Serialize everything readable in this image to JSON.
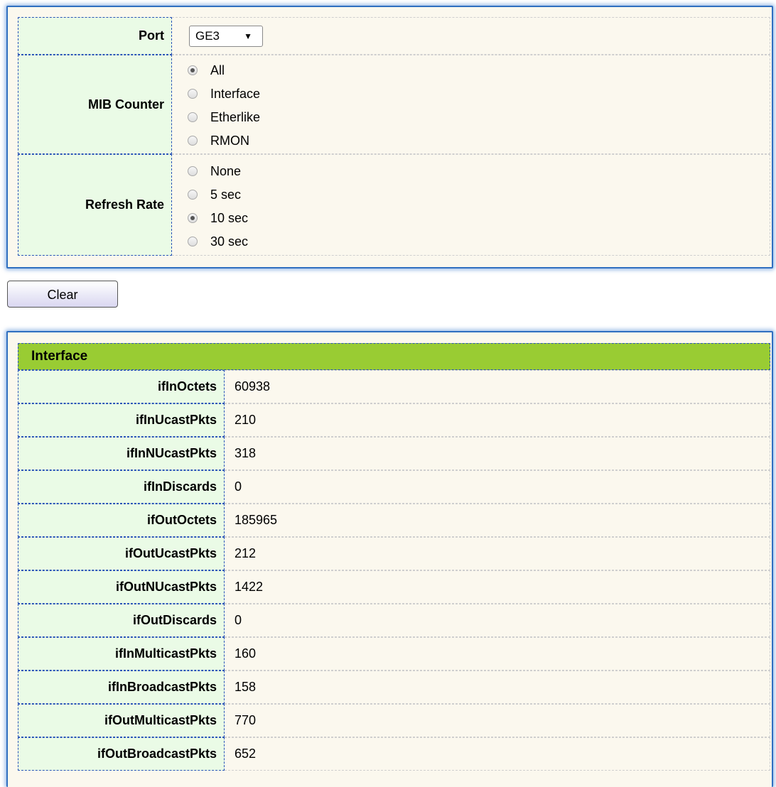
{
  "settings": {
    "port": {
      "label": "Port",
      "value": "GE3"
    },
    "mib_counter": {
      "label": "MIB Counter",
      "options": [
        "All",
        "Interface",
        "Etherlike",
        "RMON"
      ],
      "selected": "All"
    },
    "refresh_rate": {
      "label": "Refresh Rate",
      "options": [
        "None",
        "5 sec",
        "10 sec",
        "30 sec"
      ],
      "selected": "10 sec"
    }
  },
  "actions": {
    "clear_label": "Clear"
  },
  "stats": {
    "title": "Interface",
    "rows": [
      {
        "name": "ifInOctets",
        "value": "60938"
      },
      {
        "name": "ifInUcastPkts",
        "value": "210"
      },
      {
        "name": "ifInNUcastPkts",
        "value": "318"
      },
      {
        "name": "ifInDiscards",
        "value": "0"
      },
      {
        "name": "ifOutOctets",
        "value": "185965"
      },
      {
        "name": "ifOutUcastPkts",
        "value": "212"
      },
      {
        "name": "ifOutNUcastPkts",
        "value": "1422"
      },
      {
        "name": "ifOutDiscards",
        "value": "0"
      },
      {
        "name": "ifInMulticastPkts",
        "value": "160"
      },
      {
        "name": "ifInBroadcastPkts",
        "value": "158"
      },
      {
        "name": "ifOutMulticastPkts",
        "value": "770"
      },
      {
        "name": "ifOutBroadcastPkts",
        "value": "652"
      }
    ]
  }
}
